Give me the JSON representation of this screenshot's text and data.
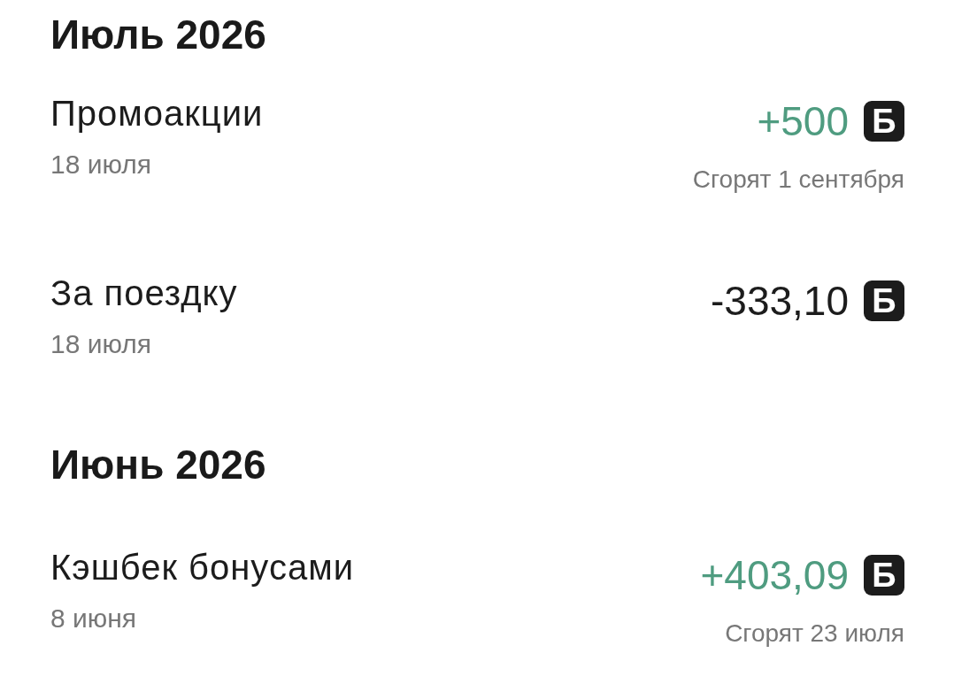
{
  "sections": [
    {
      "heading": "Июль 2026",
      "transactions": [
        {
          "title": "Промоакции",
          "date": "18 июля",
          "amount": "+500",
          "kind": "credit",
          "currency": "Б",
          "expiry": "Сгорят 1 сентября"
        },
        {
          "title": "За поездку",
          "date": "18 июля",
          "amount": "-333,10",
          "kind": "debit",
          "currency": "Б"
        }
      ]
    },
    {
      "heading": "Июнь 2026",
      "transactions": [
        {
          "title": "Кэшбек бонусами",
          "date": "8 июня",
          "amount": "+403,09",
          "kind": "credit",
          "currency": "Б",
          "expiry": "Сгорят 23 июля"
        }
      ]
    }
  ]
}
